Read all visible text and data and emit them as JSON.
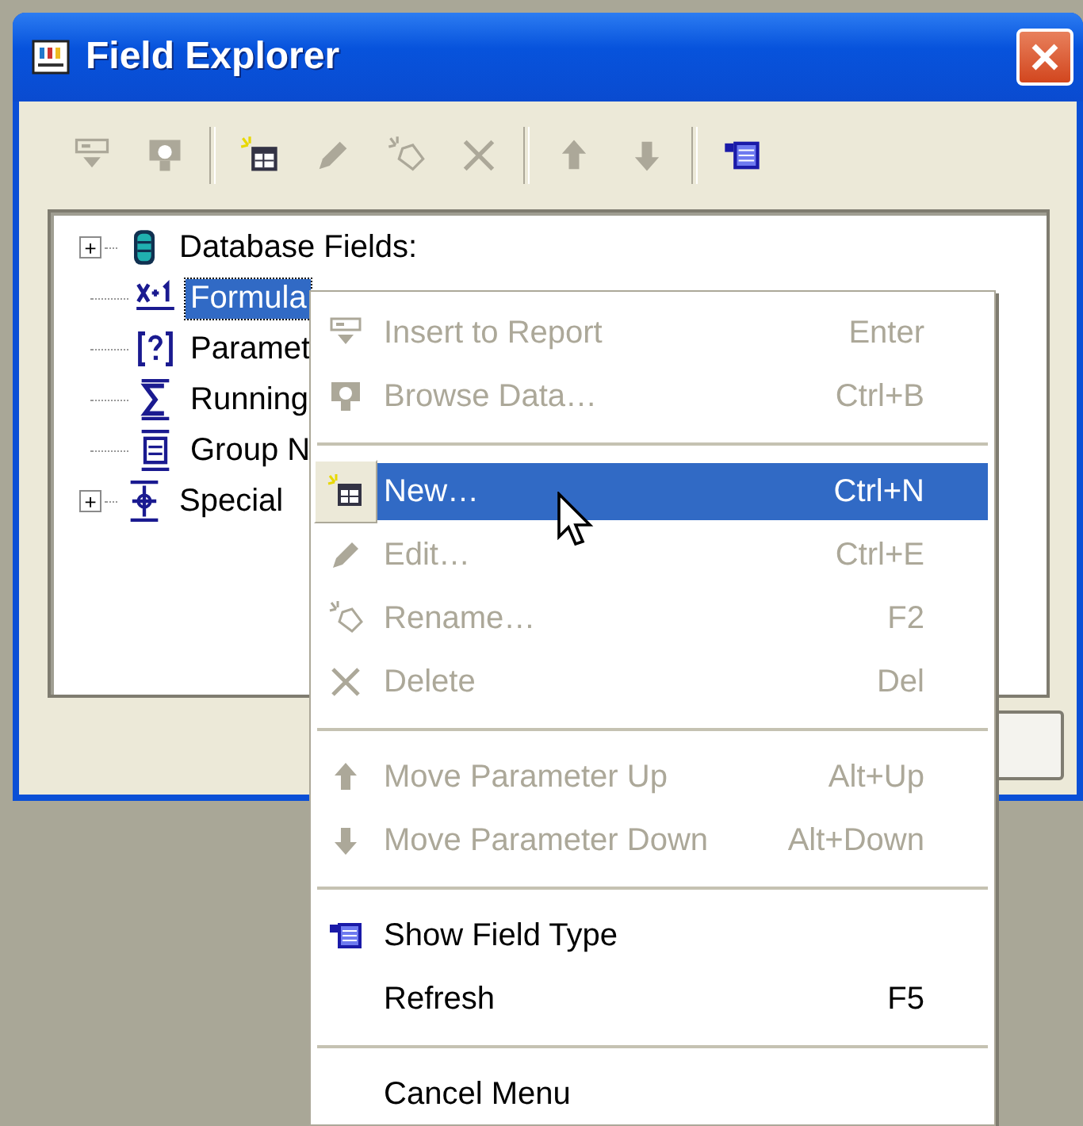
{
  "window": {
    "title": "Field Explorer"
  },
  "toolbar": [
    {
      "kind": "insert",
      "disabled": true
    },
    {
      "kind": "browse",
      "disabled": true
    },
    {
      "kind": "separator"
    },
    {
      "kind": "new",
      "disabled": false
    },
    {
      "kind": "edit",
      "disabled": true
    },
    {
      "kind": "rename",
      "disabled": true
    },
    {
      "kind": "delete",
      "disabled": true
    },
    {
      "kind": "separator"
    },
    {
      "kind": "up",
      "disabled": true
    },
    {
      "kind": "down",
      "disabled": true
    },
    {
      "kind": "separator"
    },
    {
      "kind": "fieldtype",
      "disabled": false
    }
  ],
  "tree": [
    {
      "kind": "database",
      "toggle": "+",
      "label": "Database Fields:",
      "selected": false
    },
    {
      "kind": "formula",
      "label": "Formula",
      "selected": true
    },
    {
      "kind": "parameter",
      "label": "Paramet",
      "selected": false
    },
    {
      "kind": "sigma",
      "label": "Running",
      "selected": false
    },
    {
      "kind": "group",
      "label": "Group N",
      "selected": false
    },
    {
      "kind": "special",
      "toggle": "+",
      "label": "Special",
      "selected": false
    }
  ],
  "context_menu": [
    {
      "kind": "insert",
      "label": "Insert to Report",
      "shortcut": "Enter",
      "disabled": true,
      "selected": false
    },
    {
      "kind": "browse",
      "label": "Browse Data…",
      "shortcut": "Ctrl+B",
      "disabled": true,
      "selected": false
    },
    {
      "kind": "separator"
    },
    {
      "kind": "new",
      "label": "New…",
      "shortcut": "Ctrl+N",
      "disabled": false,
      "selected": true
    },
    {
      "kind": "edit",
      "label": "Edit…",
      "shortcut": "Ctrl+E",
      "disabled": true,
      "selected": false
    },
    {
      "kind": "rename",
      "label": "Rename…",
      "shortcut": "F2",
      "disabled": true,
      "selected": false
    },
    {
      "kind": "delete",
      "label": "Delete",
      "shortcut": "Del",
      "disabled": true,
      "selected": false
    },
    {
      "kind": "separator"
    },
    {
      "kind": "up",
      "label": "Move Parameter Up",
      "shortcut": "Alt+Up",
      "disabled": true,
      "selected": false
    },
    {
      "kind": "down",
      "label": "Move Parameter Down",
      "shortcut": "Alt+Down",
      "disabled": true,
      "selected": false
    },
    {
      "kind": "separator"
    },
    {
      "kind": "fieldtype",
      "label": "Show Field Type",
      "disabled": false,
      "selected": false
    },
    {
      "kind": "item",
      "label": "Refresh",
      "shortcut": "F5",
      "disabled": false,
      "selected": false
    },
    {
      "kind": "separator"
    },
    {
      "kind": "item",
      "label": "Cancel Menu",
      "disabled": false,
      "selected": false
    }
  ]
}
